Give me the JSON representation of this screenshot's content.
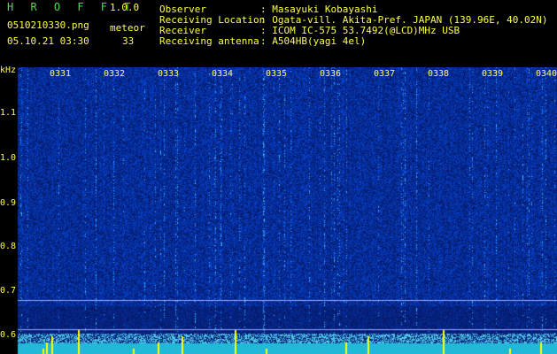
{
  "app": {
    "title": "H R O F F T",
    "version": "1.0.0",
    "filename": "0510210330.png",
    "datetime": "05.10.21 03:30",
    "count_label": "meteor",
    "count_value": "33"
  },
  "info": {
    "observer_label": "Observer",
    "observer_value": ": Masayuki Kobayashi",
    "location_label": "Receiving Location",
    "location_value": ": Ogata-vill. Akita-Pref. JAPAN (139.96E, 40.02N)",
    "receiver_label": "Receiver",
    "receiver_value": ": ICOM IC-575 53.7492(@LCD)MHz USB",
    "antenna_label": "Receiving antenna",
    "antenna_value": ": A504HB(yagi 4el)"
  },
  "axis": {
    "unit": "kHz",
    "yticks": [
      "1.1",
      "1.0",
      "0.9",
      "0.8",
      "0.7",
      "0.6"
    ],
    "xticks": [
      "0331",
      "0332",
      "0333",
      "0334",
      "0335",
      "0336",
      "0337",
      "0338",
      "0339",
      "0340"
    ]
  },
  "colors": {
    "background": "#000000",
    "header_text": "#3ee63e",
    "label_text": "#ffff44",
    "noise_base": "#0a1a8a",
    "signal": "#ffff00"
  }
}
